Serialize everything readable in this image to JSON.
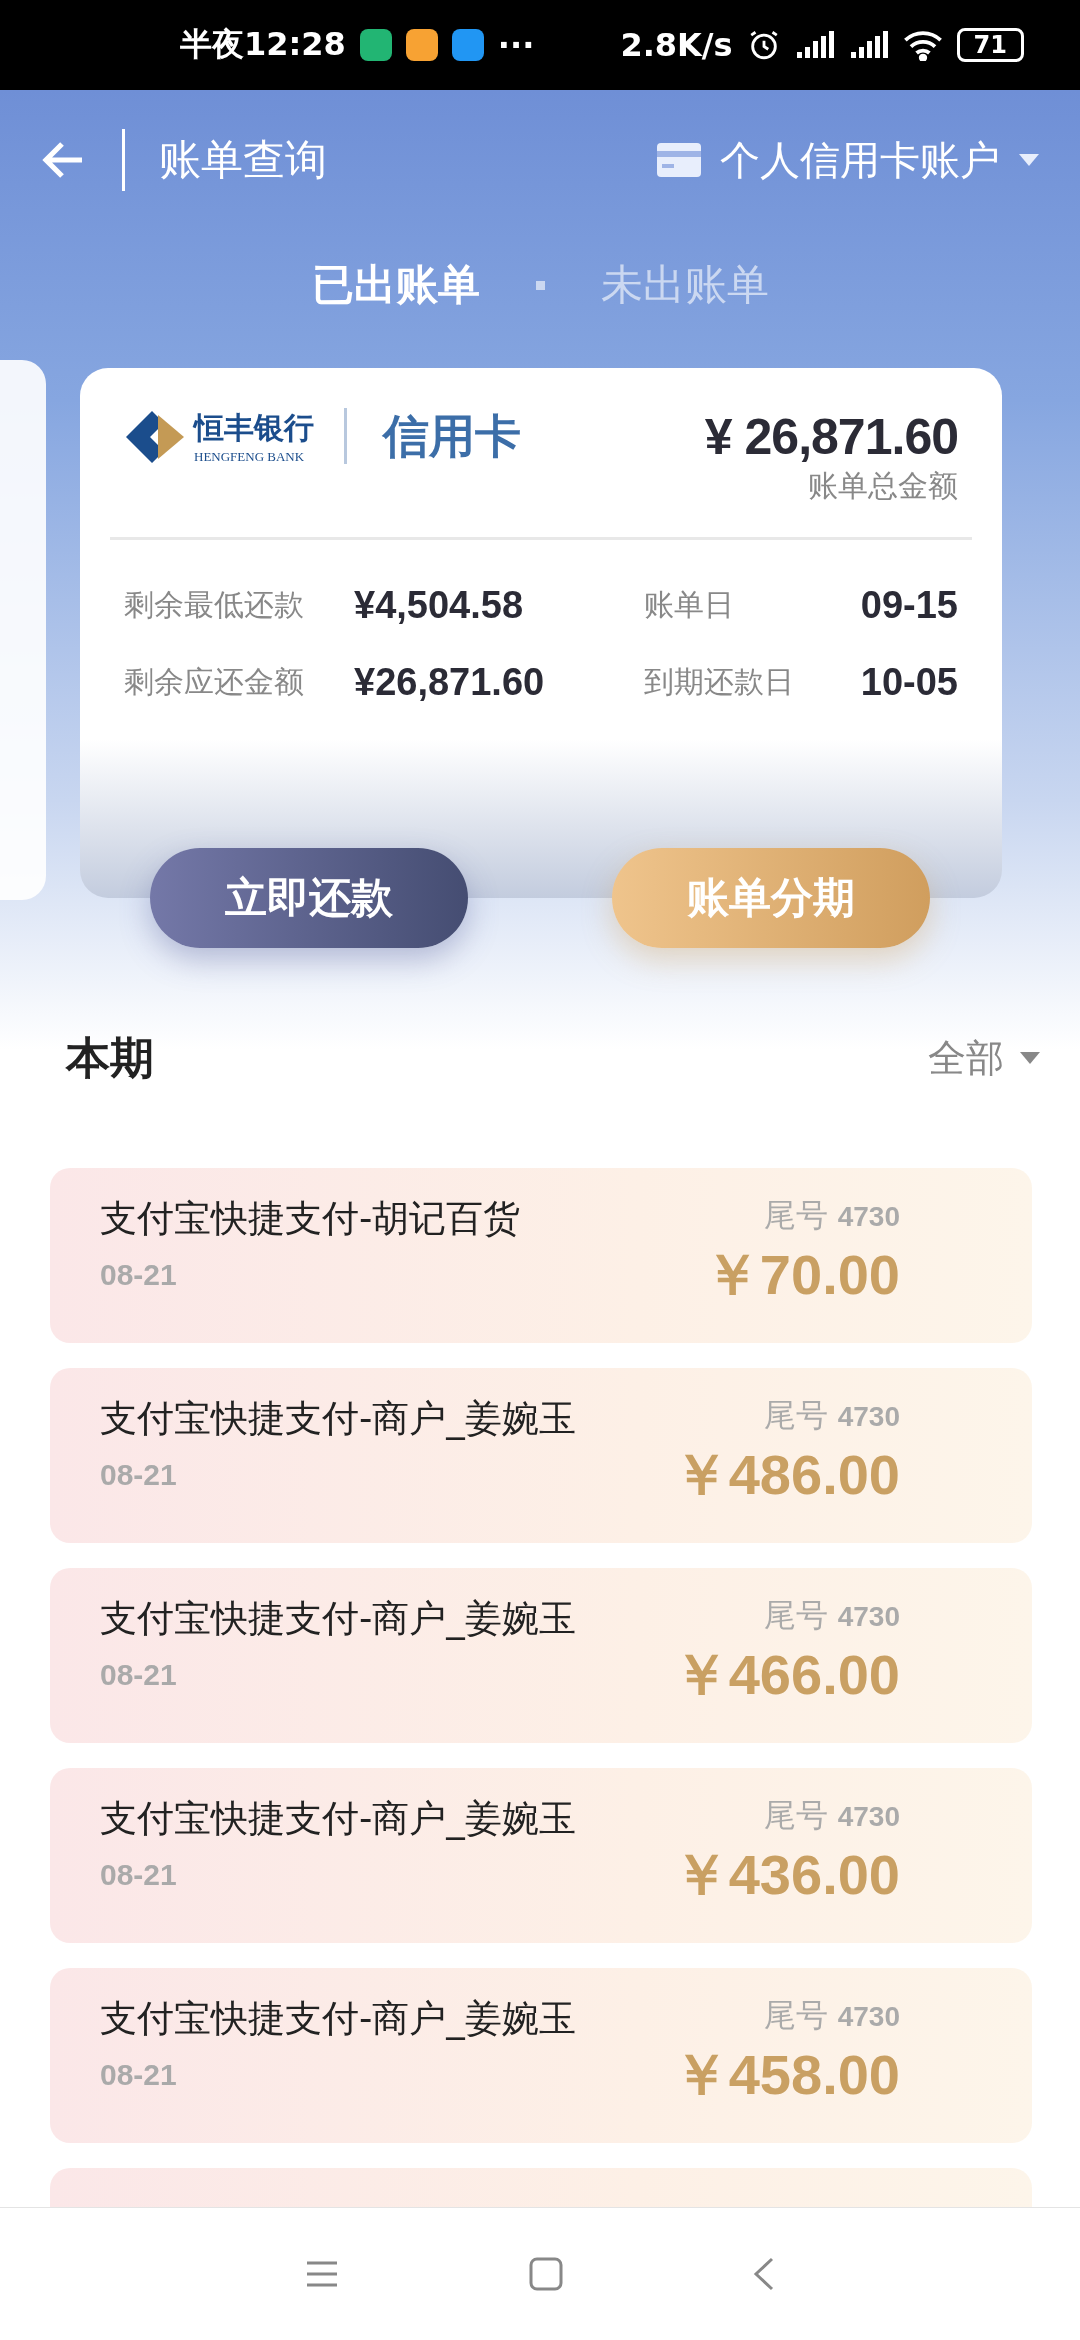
{
  "status_bar": {
    "time": "半夜12:28",
    "more": "···",
    "speed": "2.8K/s",
    "battery": "71"
  },
  "header": {
    "title": "账单查询",
    "account": "个人信用卡账户"
  },
  "tabs": [
    {
      "label": "已出账单",
      "selected": true
    },
    {
      "label": "未出账单",
      "selected": false
    }
  ],
  "card": {
    "bank_name": "恒丰银行",
    "bank_name_en": "HENGFENG BANK",
    "card_type": "信用卡",
    "total": "¥ 26,871.60",
    "total_label": "账单总金额",
    "details": [
      {
        "label": "剩余最低还款",
        "value": "¥4,504.58"
      },
      {
        "label": "账单日",
        "value": "09-15"
      },
      {
        "label": "剩余应还金额",
        "value": "¥26,871.60"
      },
      {
        "label": "到期还款日",
        "value": "10-05"
      }
    ]
  },
  "actions": [
    {
      "label": "立即还款",
      "kind": "dark"
    },
    {
      "label": "账单分期",
      "kind": "gold"
    }
  ],
  "section": {
    "title": "本期",
    "filter": "全部"
  },
  "transactions": [
    {
      "title": "支付宝快捷支付-胡记百货",
      "date": "08-21",
      "card_tail_label": "尾号",
      "card_tail": "4730",
      "amount": "￥70.00"
    },
    {
      "title": "支付宝快捷支付-商户_姜婉玉",
      "date": "08-21",
      "card_tail_label": "尾号",
      "card_tail": "4730",
      "amount": "￥486.00"
    },
    {
      "title": "支付宝快捷支付-商户_姜婉玉",
      "date": "08-21",
      "card_tail_label": "尾号",
      "card_tail": "4730",
      "amount": "￥466.00"
    },
    {
      "title": "支付宝快捷支付-商户_姜婉玉",
      "date": "08-21",
      "card_tail_label": "尾号",
      "card_tail": "4730",
      "amount": "￥436.00"
    },
    {
      "title": "支付宝快捷支付-商户_姜婉玉",
      "date": "08-21",
      "card_tail_label": "尾号",
      "card_tail": "4730",
      "amount": "￥458.00"
    }
  ]
}
